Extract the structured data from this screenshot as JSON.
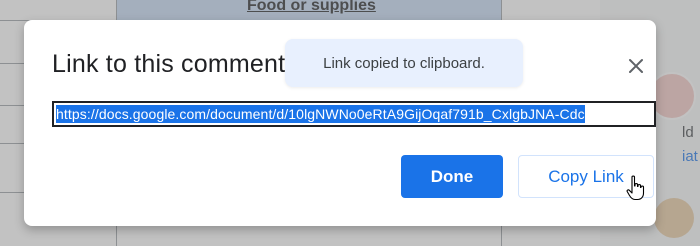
{
  "background": {
    "table_header": "Food or supplies",
    "side_texts": [
      "ld",
      "iat"
    ]
  },
  "dialog": {
    "title": "Link to this comment",
    "close_icon": "close-icon",
    "toast": "Link copied to clipboard.",
    "link_value": "https://docs.google.com/document/d/10lgNWNo0eRtA9GijOqaf791b_CxlgbJNA-Cdc",
    "done_label": "Done",
    "copy_label": "Copy Link",
    "cursor_icon": "hand-pointer-icon"
  },
  "colors": {
    "accent": "#1a73e8",
    "toast_bg": "#e8f0fe",
    "header_cell": "#c6dbf5"
  }
}
